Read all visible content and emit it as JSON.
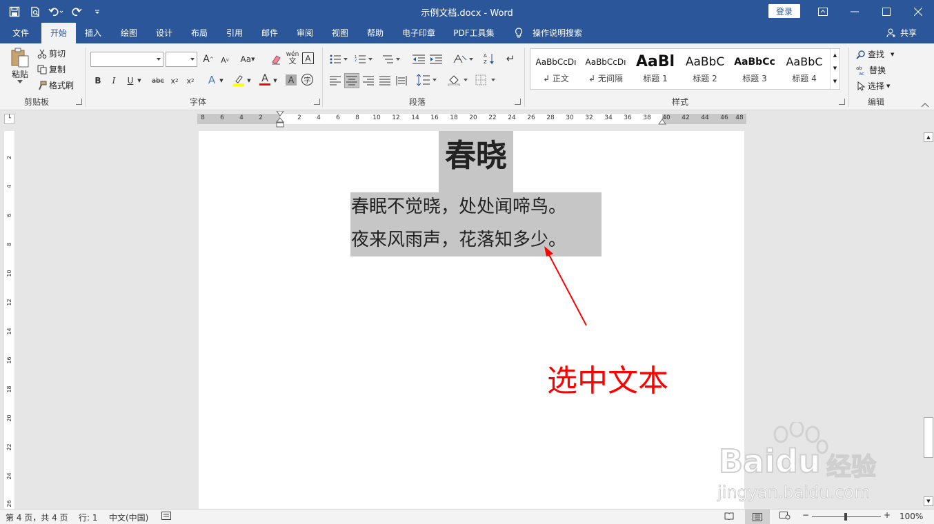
{
  "titlebar": {
    "title": "示例文档.docx - Word",
    "login_label": "登录",
    "bg": "#2b579a"
  },
  "qat": {
    "icons": [
      "save-icon",
      "print-preview-icon",
      "undo-icon",
      "redo-icon",
      "customize-icon"
    ]
  },
  "menu": {
    "tabs": [
      "文件",
      "开始",
      "插入",
      "绘图",
      "设计",
      "布局",
      "引用",
      "邮件",
      "审阅",
      "视图",
      "帮助",
      "电子印章",
      "PDF工具集"
    ],
    "active": "开始",
    "tell_me": "操作说明搜索",
    "share": "共享"
  },
  "ribbon": {
    "clipboard": {
      "paste": "粘贴",
      "cut": "剪切",
      "copy": "复制",
      "format_painter": "格式刷",
      "label": "剪贴板"
    },
    "font": {
      "label": "字体",
      "font_name": "",
      "font_size": "",
      "change_case": "Aa"
    },
    "paragraph": {
      "label": "段落"
    },
    "styles": {
      "label": "样式",
      "items": [
        {
          "preview": "AaBbCcDı",
          "name": "↲ 正文"
        },
        {
          "preview": "AaBbCcDı",
          "name": "↲ 无间隔"
        },
        {
          "preview": "AaBl",
          "name": "标题 1"
        },
        {
          "preview": "AaBbC",
          "name": "标题 2"
        },
        {
          "preview": "AaBbCc",
          "name": "标题 3"
        },
        {
          "preview": "AaBbC",
          "name": "标题 4"
        }
      ]
    },
    "editing": {
      "label": "编辑",
      "find": "查找",
      "replace": "替换",
      "select": "选择"
    }
  },
  "ruler": {
    "left_numbers": [
      "8",
      "6",
      "4",
      "2"
    ],
    "right_numbers": [
      "2",
      "4",
      "6",
      "8",
      "10",
      "12",
      "14",
      "16",
      "18",
      "20",
      "22",
      "24",
      "26",
      "28",
      "30",
      "32",
      "34",
      "36",
      "38",
      "40",
      "42",
      "44",
      "46",
      "48"
    ]
  },
  "vruler": {
    "numbers": [
      "2",
      "4",
      "6",
      "8",
      "10",
      "12",
      "14",
      "16",
      "18",
      "20",
      "22",
      "24",
      "26"
    ]
  },
  "document": {
    "title": "春晓",
    "lines": [
      "春眠不觉晓，处处闻啼鸟。",
      "夜来风雨声，花落知多少。"
    ]
  },
  "annotation": {
    "text": "选中文本",
    "color": "#ff0000"
  },
  "status": {
    "page": "第 4 页，共 4 页",
    "line": "行: 1",
    "lang": "中文(中国)",
    "zoom": "100%"
  },
  "watermark": {
    "brand": "Bai",
    "brand2": "du",
    "cn": "经验",
    "url": "jingyan.baidu.com"
  }
}
